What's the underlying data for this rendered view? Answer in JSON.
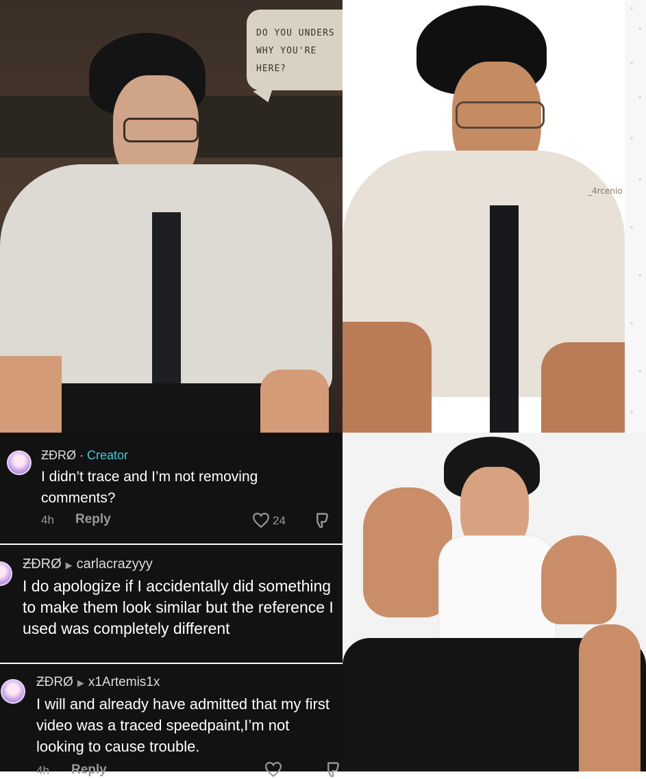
{
  "illustration_left": {
    "speech_bubble": "DO YOU UNDERS\nWHY YOU'RE\nHERE?"
  },
  "illustration_right": {
    "watermark": "_4rcenio"
  },
  "comments": [
    {
      "username": "ƵƉRØ",
      "separator": " · ",
      "badge": "Creator",
      "text": "I didn’t trace and I’m not removing comments?",
      "time": "4h",
      "reply_label": "Reply",
      "likes": "24"
    },
    {
      "username": "ƵƉRØ",
      "reply_to": "carlacrazyyy",
      "text": "I do apologize if I accidentally did something to make them look similar but the reference I used was completely different"
    },
    {
      "username": "ƵƉRØ",
      "reply_to": "x1Artemis1x",
      "text": "I will and already have admitted that my first video was a traced speedpaint,I’m not looking to cause trouble.",
      "time": "4h",
      "reply_label": "Reply"
    }
  ],
  "icons": [
    "heart-icon",
    "dislike-icon",
    "reply-arrow-icon",
    "avatar"
  ],
  "colors": {
    "card_bg": "#121212",
    "creator_badge": "#42c8d9",
    "muted_text": "#9a9a9a"
  }
}
